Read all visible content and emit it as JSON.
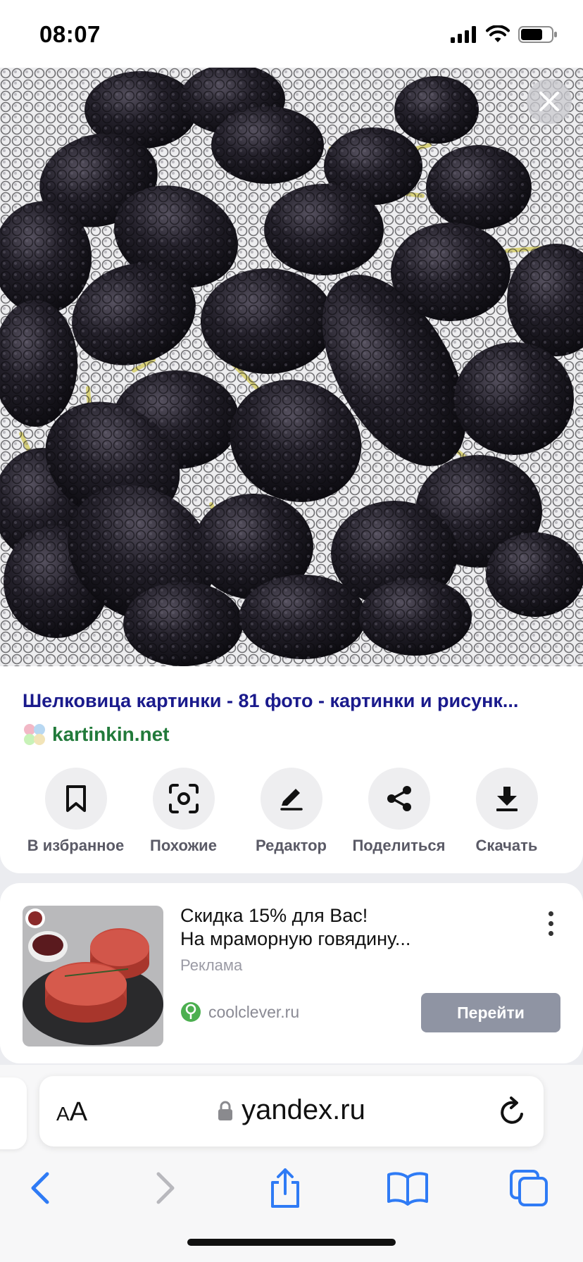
{
  "status_bar": {
    "time": "08:07"
  },
  "viewer": {
    "close_label": "close",
    "result_title": "Шелковица картинки - 81 фото - картинки и рисунк...",
    "source_domain": "kartinkin.net",
    "actions": [
      {
        "label": "В избранное",
        "icon": "bookmark-icon"
      },
      {
        "label": "Похожие",
        "icon": "similar-search-icon"
      },
      {
        "label": "Редактор",
        "icon": "edit-pencil-icon"
      },
      {
        "label": "Поделиться",
        "icon": "share-icon"
      },
      {
        "label": "Скачать",
        "icon": "download-icon"
      }
    ]
  },
  "ad": {
    "title_line1": "Скидка 15% для Вас!",
    "title_line2": "На мраморную говядину...",
    "label": "Реклама",
    "domain": "coolclever.ru",
    "button": "Перейти"
  },
  "browser": {
    "text_size_big": "A",
    "text_size_small": "A",
    "url": "yandex.ru",
    "toolbar": [
      "back-icon",
      "forward-icon",
      "share-icon",
      "bookmarks-icon",
      "tabs-icon"
    ]
  },
  "colors": {
    "title_link": "#1a1a8c",
    "domain_green": "#217a3a",
    "ios_blue": "#2f7bf5",
    "go_button": "#8f94a3"
  }
}
